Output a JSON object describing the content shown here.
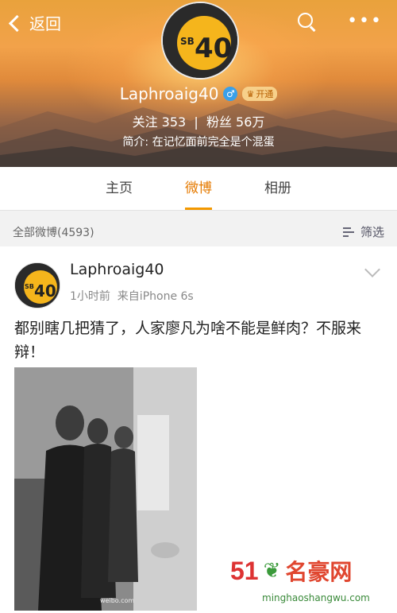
{
  "nav": {
    "back_label": "返回",
    "search_icon": "search-icon",
    "more_icon": "more-icon"
  },
  "profile": {
    "avatar_text": "SB40",
    "username": "Laphroaig40",
    "gender": "♂",
    "vip_label": "开通",
    "stats": "关注 353  |  粉丝 56万",
    "bio": "简介: 在记忆面前完全是个混蛋"
  },
  "tabs": [
    {
      "label": "主页",
      "active": false
    },
    {
      "label": "微博",
      "active": true
    },
    {
      "label": "相册",
      "active": false
    }
  ],
  "filterbar": {
    "all_label": "全部微博(4593)",
    "filter_label": "筛选"
  },
  "post": {
    "username": "Laphroaig40",
    "meta": "1小时前  来自iPhone 6s",
    "text": "都别瞎几把猜了，人家廖凡为啥不能是鲜肉？不服来辩！",
    "photo_caption": "weibo.com"
  },
  "watermark": {
    "logo": "51",
    "name": "名豪网",
    "url": "minghaoshangwu.com"
  },
  "colors": {
    "accent": "#f39800",
    "tab_active": "#e57a00",
    "link": "#3aa0e8"
  }
}
